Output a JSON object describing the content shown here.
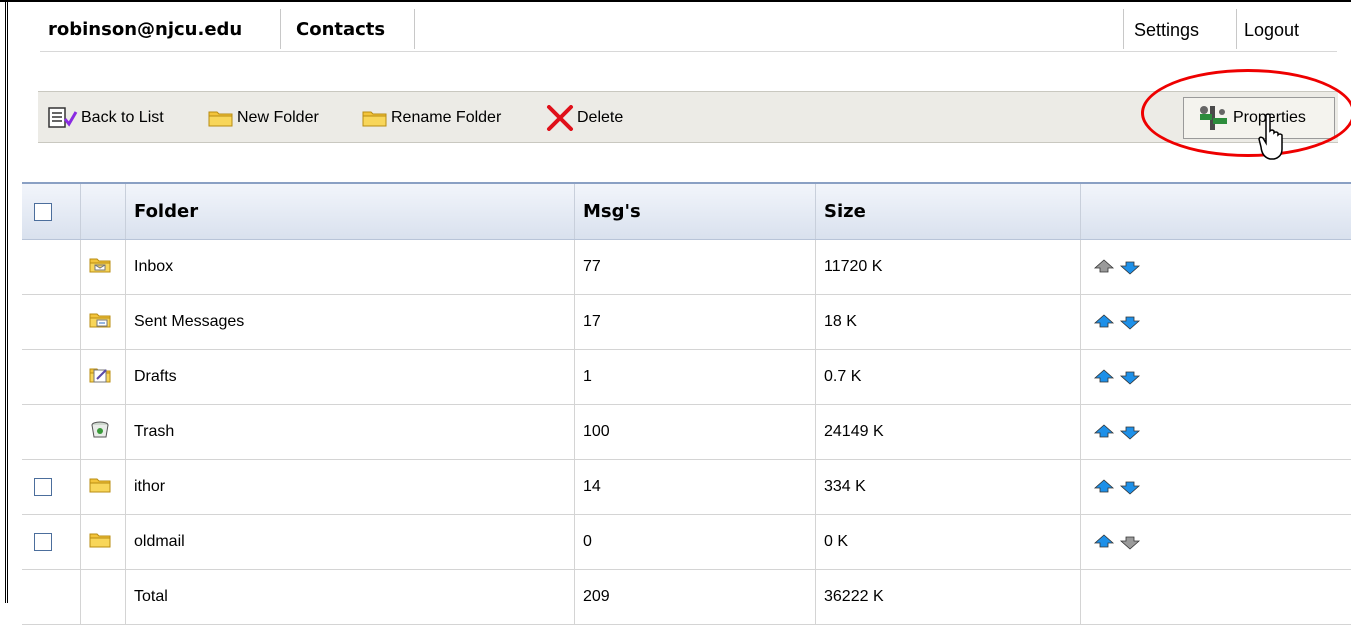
{
  "header": {
    "account": "robinson@njcu.edu",
    "contacts_label": "Contacts",
    "settings_label": "Settings",
    "logout_label": "Logout"
  },
  "toolbar": {
    "back_label": "Back to List",
    "new_folder_label": "New Folder",
    "rename_folder_label": "Rename Folder",
    "delete_label": "Delete",
    "properties_label": "Properties"
  },
  "table": {
    "columns": {
      "folder": "Folder",
      "msgs": "Msg's",
      "size": "Size"
    },
    "rows": [
      {
        "name": "Inbox",
        "msgs": "77",
        "size": "11720 K",
        "icon": "inbox-folder-icon",
        "checkbox": false,
        "up_enabled": false,
        "down_enabled": true
      },
      {
        "name": "Sent Messages",
        "msgs": "17",
        "size": "18 K",
        "icon": "sent-folder-icon",
        "checkbox": false,
        "up_enabled": true,
        "down_enabled": true
      },
      {
        "name": "Drafts",
        "msgs": "1",
        "size": "0.7 K",
        "icon": "drafts-folder-icon",
        "checkbox": false,
        "up_enabled": true,
        "down_enabled": true
      },
      {
        "name": "Trash",
        "msgs": "100",
        "size": "24149 K",
        "icon": "trash-folder-icon",
        "checkbox": false,
        "up_enabled": true,
        "down_enabled": true
      },
      {
        "name": "ithor",
        "msgs": "14",
        "size": "334 K",
        "icon": "folder-icon",
        "checkbox": true,
        "up_enabled": true,
        "down_enabled": true
      },
      {
        "name": "oldmail",
        "msgs": "0",
        "size": "0 K",
        "icon": "folder-icon",
        "checkbox": true,
        "up_enabled": true,
        "down_enabled": false
      }
    ],
    "total": {
      "label": "Total",
      "msgs": "209",
      "size": "36222 K"
    }
  },
  "colors": {
    "highlight": "#ee0000",
    "arrow_active": "#1e90e8",
    "arrow_disabled": "#9a9a9a"
  }
}
